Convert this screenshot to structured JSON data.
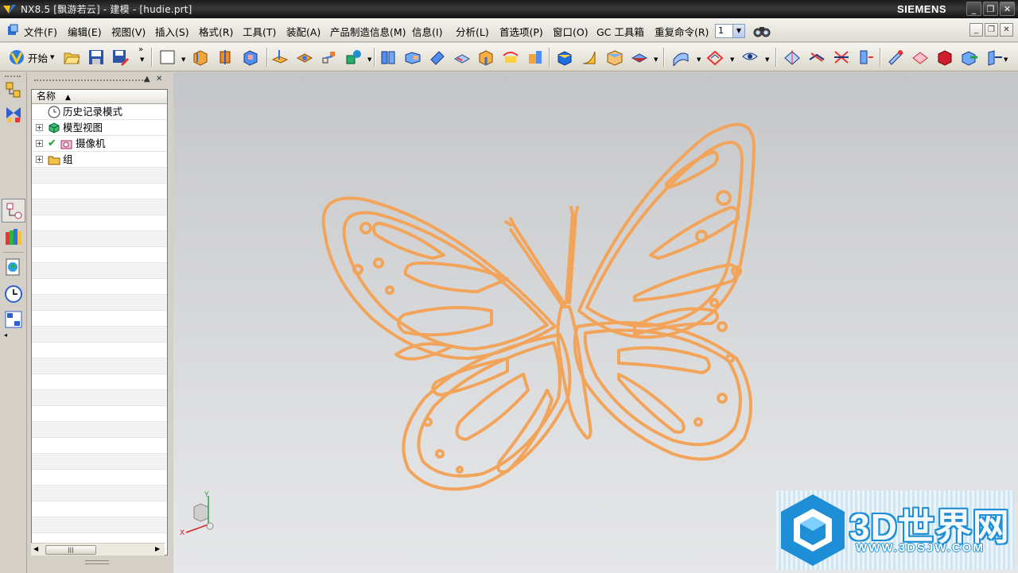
{
  "window": {
    "title": "NX8.5 [飘游若云] - 建模 - [hudie.prt]",
    "brand": "SIEMENS",
    "controls": {
      "minimize": "_",
      "restore": "❐",
      "close": "✕"
    }
  },
  "menubar": {
    "items": [
      "文件(F)",
      "编辑(E)",
      "视图(V)",
      "插入(S)",
      "格式(R)",
      "工具(T)",
      "装配(A)",
      "产品制造信息(M)",
      "信息(I)",
      "分析(L)",
      "首选项(P)",
      "窗口(O)",
      "GC 工具箱",
      "重复命令(R)"
    ],
    "repeat_count": "1"
  },
  "toolbar": {
    "start_label": "开始",
    "icons": [
      "start-icon",
      "open-icon",
      "save-icon",
      "save-as-icon",
      "sketch-icon",
      "extrude-icon",
      "revolve-icon",
      "block-icon",
      "datum-plane-icon",
      "datum-csys-icon",
      "point-icon",
      "body-icon",
      "unite-icon",
      "subtract-icon",
      "intersect-icon",
      "edge-blend-icon",
      "chamfer-icon",
      "shell-icon",
      "draft-icon",
      "mirror-icon",
      "pattern-icon",
      "trim-icon",
      "offset-icon",
      "sew-icon",
      "thicken-icon",
      "surface-icon",
      "section-icon",
      "measure-icon",
      "analysis-icon",
      "view-icon",
      "render-icon",
      "csys-icon",
      "transform-icon"
    ]
  },
  "resource_bar": {
    "icons": [
      "assembly-navigator-icon",
      "constraint-navigator-icon",
      "part-navigator-icon",
      "reuse-library-icon",
      "web-browser-icon",
      "history-icon",
      "system-materials-icon"
    ]
  },
  "navigator": {
    "column_header": "名称",
    "rows": [
      {
        "label": "历史记录模式",
        "icon": "clock-icon",
        "expandable": false
      },
      {
        "label": "模型视图",
        "icon": "model-view-icon",
        "expandable": true
      },
      {
        "label": "摄像机",
        "icon": "camera-icon",
        "expandable": true
      },
      {
        "label": "组",
        "icon": "folder-icon",
        "expandable": true
      }
    ]
  },
  "viewport": {
    "curve_color": "#f2a55a",
    "triad": {
      "x": "X",
      "y": "Y"
    }
  },
  "watermark": {
    "text": "3D世界网",
    "url": "WWW.3DSJW.COM"
  }
}
